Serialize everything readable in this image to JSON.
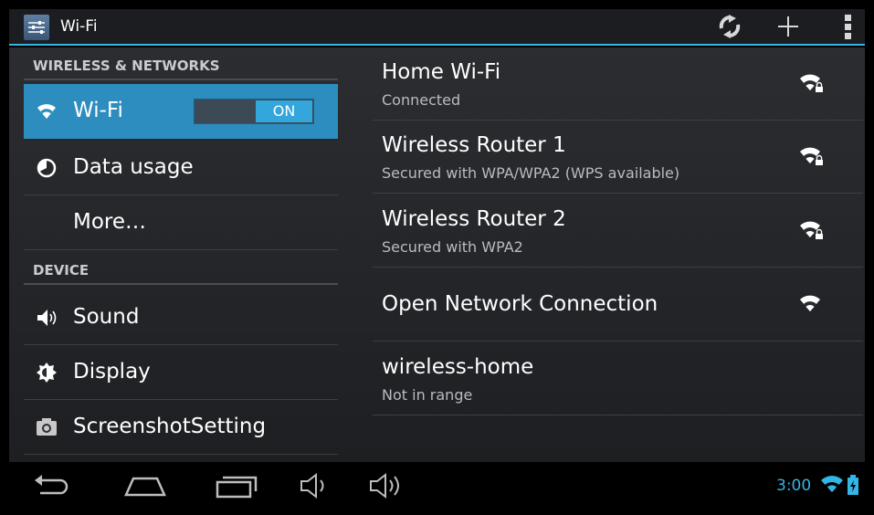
{
  "actionbar": {
    "title": "Wi-Fi",
    "icons": [
      "settings-icon",
      "wps-scan-icon",
      "add-network-icon",
      "overflow-menu-icon"
    ]
  },
  "settings": {
    "category_wireless": "WIRELESS & NETWORKS",
    "category_device": "DEVICE",
    "items": [
      {
        "label": "Wi-Fi",
        "icon": "wifi-icon",
        "active": true,
        "toggle": "ON"
      },
      {
        "label": "Data usage",
        "icon": "data-usage-icon"
      },
      {
        "label": "More…"
      },
      {
        "label": "Sound",
        "icon": "sound-icon"
      },
      {
        "label": "Display",
        "icon": "display-icon"
      },
      {
        "label": "ScreenshotSetting",
        "icon": "camera-icon"
      }
    ]
  },
  "networks": [
    {
      "name": "Home Wi-Fi",
      "status": "Connected",
      "secured": true
    },
    {
      "name": "Wireless Router 1",
      "status": "Secured with WPA/WPA2 (WPS available)",
      "secured": true
    },
    {
      "name": "Wireless Router 2",
      "status": "Secured with WPA2",
      "secured": true
    },
    {
      "name": "Open Network Connection",
      "status": "",
      "secured": false
    },
    {
      "name": "wireless-home",
      "status": "Not in range",
      "secured": false
    }
  ],
  "statusbar": {
    "time": "3:00"
  },
  "colors": {
    "accent": "#33b5e5",
    "active_item": "#2e8dbf"
  }
}
